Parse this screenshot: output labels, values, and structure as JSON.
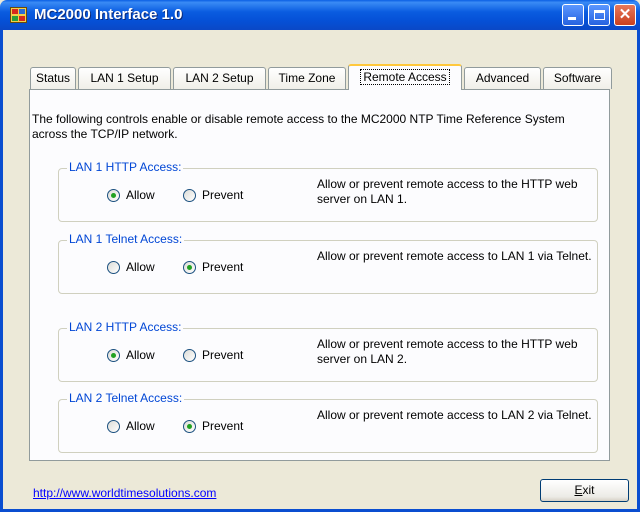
{
  "window": {
    "title": "MC2000 Interface 1.0",
    "minimize_symbol": "_",
    "maximize_symbol": "□",
    "close_symbol": "✕"
  },
  "tabs": [
    {
      "label": "Status"
    },
    {
      "label": "LAN 1 Setup"
    },
    {
      "label": "LAN 2 Setup"
    },
    {
      "label": "Time Zone"
    },
    {
      "label": "Remote Access",
      "active": true
    },
    {
      "label": "Advanced"
    },
    {
      "label": "Software"
    }
  ],
  "intro": "The following controls enable or disable remote access to the MC2000 NTP Time Reference System across the TCP/IP network.",
  "groups": [
    {
      "title": "LAN 1 HTTP Access:",
      "options": [
        {
          "label": "Allow",
          "selected": true
        },
        {
          "label": "Prevent",
          "selected": false
        }
      ],
      "description": "Allow or prevent remote access to the HTTP web server on LAN 1."
    },
    {
      "title": "LAN 1 Telnet Access:",
      "options": [
        {
          "label": "Allow",
          "selected": false
        },
        {
          "label": "Prevent",
          "selected": true
        }
      ],
      "description": "Allow or prevent remote access to LAN 1 via Telnet."
    },
    {
      "title": "LAN 2 HTTP Access:",
      "options": [
        {
          "label": "Allow",
          "selected": true
        },
        {
          "label": "Prevent",
          "selected": false
        }
      ],
      "description": "Allow or prevent remote access to the HTTP web server on LAN 2."
    },
    {
      "title": "LAN 2 Telnet Access:",
      "options": [
        {
          "label": "Allow",
          "selected": false
        },
        {
          "label": "Prevent",
          "selected": true
        }
      ],
      "description": "Allow or prevent remote access to LAN 2 via Telnet."
    }
  ],
  "footer": {
    "link": "http://www.worldtimesolutions.com",
    "exit_label_u": "E",
    "exit_label_rest": "xit"
  },
  "colors": {
    "accent": "#0046d5",
    "selected_radio": "#21a121",
    "link": "#0000ff"
  }
}
